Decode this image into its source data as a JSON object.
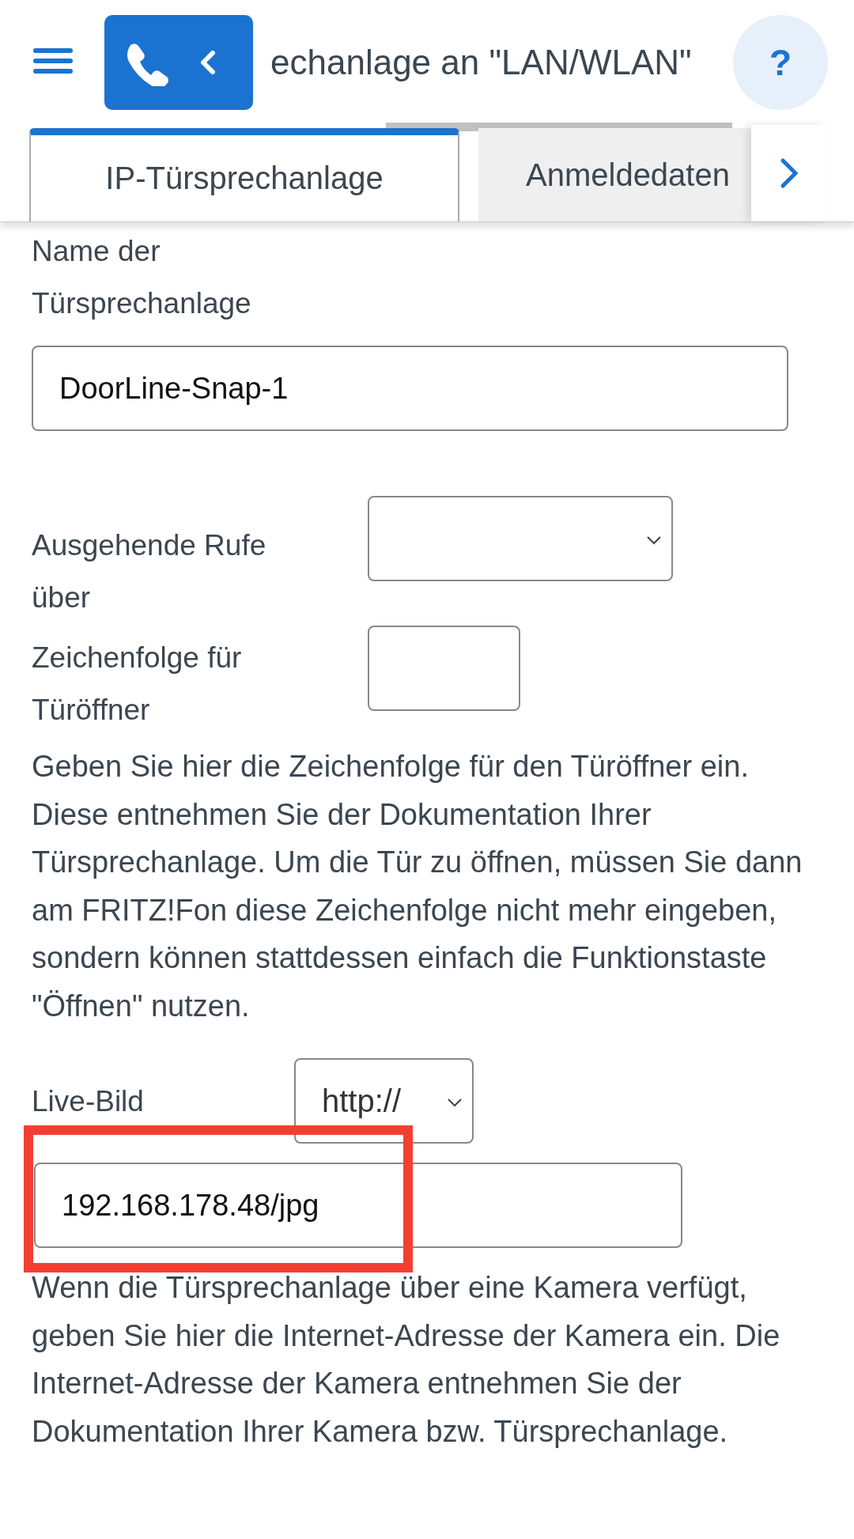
{
  "header": {
    "title": "echanlage an \"LAN/WLAN\"",
    "help": "?"
  },
  "tabs": [
    {
      "label": "IP-Türsprechanlage",
      "selected": true
    },
    {
      "label": "Anmeldedaten",
      "selected": false
    }
  ],
  "form": {
    "name_label": "Name der Türsprechanlage",
    "name_value": "DoorLine-Snap-1",
    "outgoing_label": "Ausgehende Rufe über",
    "opener_label": "Zeichenfolge für Türöffner",
    "opener_hint": "Geben Sie hier die Zeichenfolge für den Türöffner ein. Diese entnehmen Sie der Dokumentation Ihrer Türsprechanlage. Um die Tür zu öffnen, müssen Sie dann am FRITZ!Fon diese Zeichenfolge nicht mehr eingeben, sondern können stattdessen einfach die Funktionstaste \"Öffnen\" nutzen.",
    "live_label": "Live-Bild",
    "protocol": "http://",
    "live_value": "192.168.178.48/jpg",
    "live_highlighted": true,
    "live_hint": "Wenn die Türsprechanlage über eine Kamera verfügt, geben Sie hier die Internet-Adresse der Kamera ein. Die Internet-Adresse der Kamera entnehmen Sie der Dokumentation Ihrer Kamera bzw. Türsprechanlage."
  }
}
